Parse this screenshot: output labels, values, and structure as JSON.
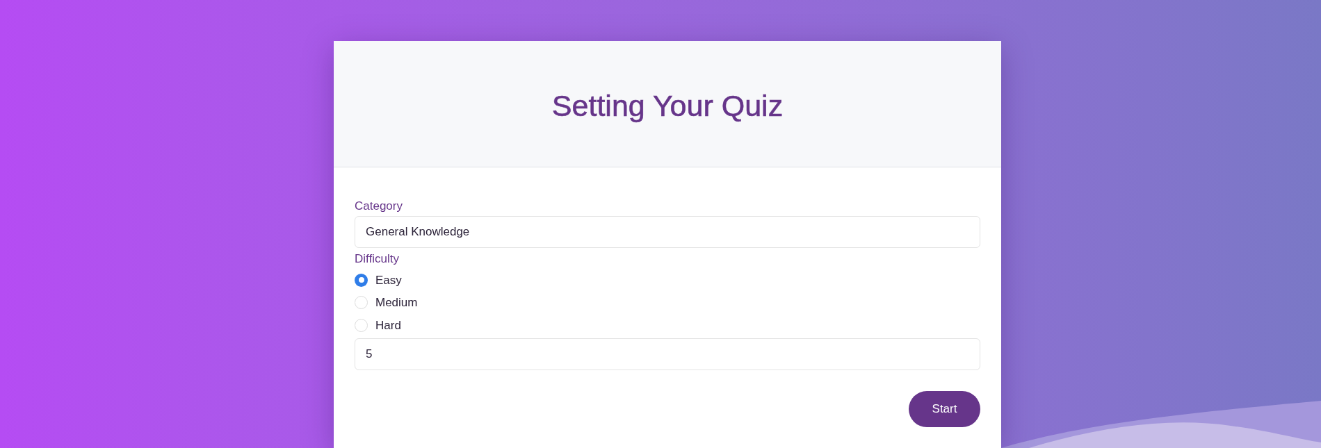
{
  "header": {
    "title": "Setting Your Quiz"
  },
  "form": {
    "category": {
      "label": "Category",
      "value": "General Knowledge"
    },
    "difficulty": {
      "label": "Difficulty",
      "options": [
        {
          "label": "Easy",
          "selected": true
        },
        {
          "label": "Medium",
          "selected": false
        },
        {
          "label": "Hard",
          "selected": false
        }
      ]
    },
    "amount": {
      "value": "5"
    },
    "start_button": {
      "label": "Start"
    }
  }
}
